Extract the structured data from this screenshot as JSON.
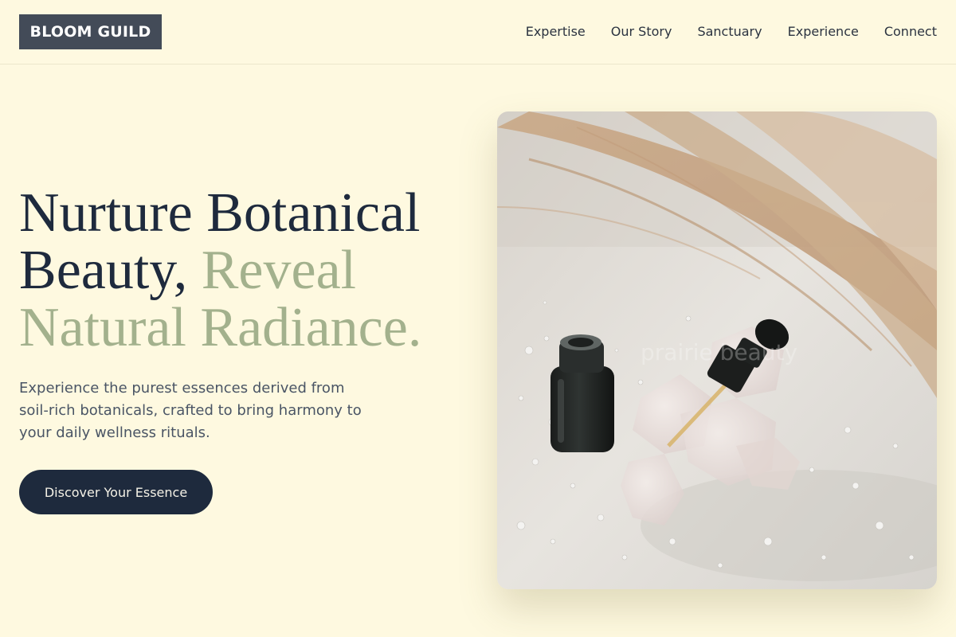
{
  "header": {
    "logo": "BLOOM GUILD",
    "nav": [
      "Expertise",
      "Our Story",
      "Sanctuary",
      "Experience",
      "Connect"
    ]
  },
  "hero": {
    "headline_dark": "Nurture Botanical Beauty,",
    "headline_accent": "Reveal Natural Radiance.",
    "lede": "Experience the purest essences derived from soil-rich botanicals, crafted to bring harmony to your daily wellness rituals.",
    "cta": "Discover Your Essence",
    "image_watermark": "prairie beauty"
  },
  "colors": {
    "background": "#fef9e0",
    "logo_bg": "#434b58",
    "headline": "#1e2a3d",
    "accent": "#a3b18d",
    "cta_bg": "#1e2a3d"
  }
}
